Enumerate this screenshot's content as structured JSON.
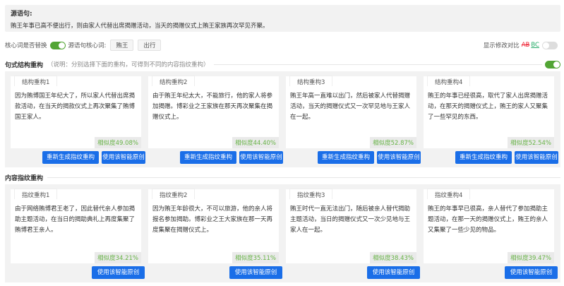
{
  "source": {
    "label": "源语句:",
    "text": "贿王年事已高不便出行，则由家人代替出席揭赠活动，当天的揭赠仪式上贿王家族再次罕见齐聚。"
  },
  "options": {
    "core_replace_label": "核心词是否替换",
    "source_core_label": "源语句核心词:",
    "tags": [
      "贿王",
      "出行"
    ],
    "diff_label": "显示修改对比",
    "diff_ab": "AB",
    "diff_bc": "BC"
  },
  "sentence_section": {
    "title": "句式结构重构",
    "note": "（说明：分别选择下面的重构，可得到不同的内容指纹重构）"
  },
  "sentence_cards": [
    {
      "tab": "结构重构1",
      "text": "因为贿博国王年纪大了，所以家人代替出席揭款活动，在当天的揭款仪式上再次聚集了贿博国王家人。",
      "similarity": "相似度49.08%",
      "regen": "重新生成指纹重构",
      "use": "使用该智能原创"
    },
    {
      "tab": "结构重构2",
      "text": "由于贿王年纪太大，不能旅行，他的家人将参加揭赠。博彩业之王家族在那天再次聚集在揭赠仪式上。",
      "similarity": "相似度44.40%",
      "regen": "重新生成指纹重构",
      "use": "使用该智能原创"
    },
    {
      "tab": "结构重构3",
      "text": "贿王年高一直难以出门，然后被家人代替揭赠活动，当天的揭赠仪式又一次罕见地与王家人在一起。",
      "similarity": "相似度52.87%",
      "regen": "重新生成指纹重构",
      "use": "使用该智能原创"
    },
    {
      "tab": "结构重构4",
      "text": "贿王的年事已经很高，取代了家人出席揭赠活动，在那天的揭赠仪式上，贿王的家人又聚集了一些罕见的东西。",
      "similarity": "相似度52.54%",
      "regen": "重新生成指纹重构",
      "use": "使用该智能原创"
    }
  ],
  "content_section": {
    "title": "内容指纹重构"
  },
  "content_cards": [
    {
      "tab": "指纹重构1",
      "text": "由于网络贿博君王老了，因此替代亲人参加揭助主题活动，在当日的揭助典礼上再度集聚了贿博君王亲人。",
      "similarity": "相似度34.21%",
      "use": "使用该智能原创"
    },
    {
      "tab": "指纹重构2",
      "text": "因为贿王年龄很大，不可以旅游，他的亲人将报名参加揭助。博彩业之王大家族在那一天再度集聚在揭赠仪式上。",
      "similarity": "相似度35.11%",
      "use": "使用该智能原创"
    },
    {
      "tab": "指纹重构3",
      "text": "贿王时代一直无法出门，随后被亲人替代揭助主题活动，当日的揭赠仪式又一次少见地与王家人在一起。",
      "similarity": "相似度38.43%",
      "use": "使用该智能原创"
    },
    {
      "tab": "指纹重构4",
      "text": "贿王的年事早已很高，亲人替代了参加揭助主题活动，在那一天的揭赠仪式上，贿王的亲人又集聚了一些少见的物品。",
      "similarity": "相似度39.47%",
      "use": "使用该智能原创"
    }
  ]
}
